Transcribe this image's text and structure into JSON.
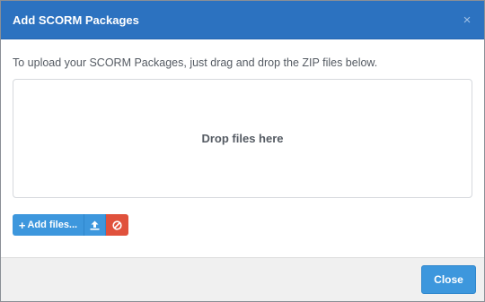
{
  "dialog": {
    "title": "Add SCORM Packages",
    "close_glyph": "×"
  },
  "body": {
    "instructions": "To upload your SCORM Packages, just drag and drop the ZIP files below.",
    "dropzone_text": "Drop files here"
  },
  "toolbar": {
    "add_files_label": "Add files...",
    "add_icon": "plus-icon",
    "upload_icon": "upload-icon",
    "cancel_icon": "cancel-icon"
  },
  "footer": {
    "close_label": "Close"
  },
  "colors": {
    "header": "#2c72c0",
    "primary_button": "#3d97dd",
    "danger_button": "#e0513c",
    "footer_bg": "#f0f0f0"
  }
}
